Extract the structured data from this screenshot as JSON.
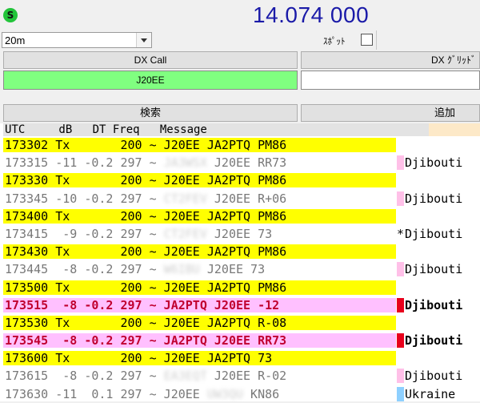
{
  "header": {
    "status_glyph": "S",
    "frequency": "14.074 000",
    "band": "20m",
    "spot_label": "ｽﾎﾟｯﾄ",
    "dx_call_label": "DX Call",
    "dx_grid_label": "DX ｸﾞﾘｯﾄﾞ",
    "dx_call_value": "J20EE",
    "dx_grid_value": "",
    "search_label": "検索",
    "add_label": "追加"
  },
  "columns": "UTC     dB   DT Freq   Message",
  "colors": {
    "tx_row": "#ffff00",
    "my_call_row": "#ffc0ff",
    "frequency": "#1a1aa8",
    "dx_call_bg": "#80ff80"
  },
  "rows": [
    {
      "t": "173302 Tx       200 ~ J20EE JA2PTQ PM86"
    },
    {
      "t": "173315 -11 -0.2 297 ~ ",
      "hidden": "JA3WSX",
      "t2": " J20EE RR73",
      "country": "Djibouti"
    },
    {
      "t": "173330 Tx       200 ~ J20EE JA2PTQ PM86"
    },
    {
      "t": "173345 -10 -0.2 297 ~ ",
      "hidden": "CT2FEV",
      "t2": " J20EE R+06",
      "country": "Djibouti"
    },
    {
      "t": "173400 Tx       200 ~ J20EE JA2PTQ PM86"
    },
    {
      "t": "173415  -9 -0.2 297 ~ ",
      "hidden": "CT2FEV",
      "t2": " J20EE 73",
      "star": "*",
      "country": "Djibouti"
    },
    {
      "t": "173430 Tx       200 ~ J20EE JA2PTQ PM86"
    },
    {
      "t": "173445  -8 -0.2 297 ~ ",
      "hidden": "W6IBU",
      "t2": " J20EE 73",
      "country": "Djibouti"
    },
    {
      "t": "173500 Tx       200 ~ J20EE JA2PTQ PM86"
    },
    {
      "t": "173515  -8 -0.2 297 ~ JA2PTQ J20EE -12",
      "country": "Djibouti"
    },
    {
      "t": "173530 Tx       200 ~ J20EE JA2PTQ R-08"
    },
    {
      "t": "173545  -8 -0.2 297 ~ JA2PTQ J20EE RR73",
      "country": "Djibouti"
    },
    {
      "t": "173600 Tx       200 ~ J20EE JA2PTQ 73"
    },
    {
      "t": "173615  -8 -0.2 297 ~ ",
      "hidden": "EA3EQT",
      "t2": " J20EE R-02",
      "country": "Djibouti"
    },
    {
      "t": "173630 -11  0.1 297 ~ J20EE ",
      "hidden": "UW3QU",
      "t2": " KN86",
      "country": "Ukraine"
    }
  ]
}
